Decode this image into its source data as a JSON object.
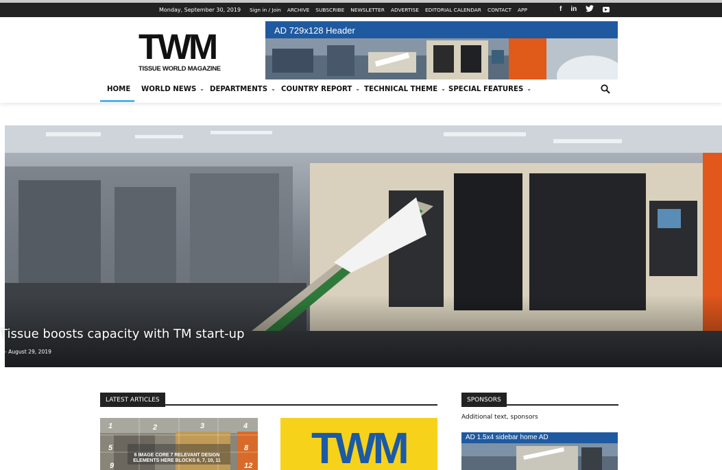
{
  "topbar": {
    "date": "Monday, September 30, 2019",
    "links": [
      "Sign in / Join",
      "ARCHIVE",
      "SUBSCRIBE",
      "NEWSLETTER",
      "ADVERTISE",
      "EDITORIAL CALENDAR",
      "CONTACT",
      "APP"
    ],
    "social": [
      "facebook-icon",
      "linkedin-icon",
      "twitter-icon",
      "youtube-icon"
    ]
  },
  "logo": {
    "mark": "TWM",
    "subtitle": "TISSUE WORLD MAGAZINE"
  },
  "header_ad": {
    "label": "AD 729x128 Header"
  },
  "nav": {
    "items": [
      "HOME",
      "WORLD NEWS",
      "DEPARTMENTS",
      "COUNTRY REPORT",
      "TECHNICAL THEME",
      "SPECIAL FEATURES"
    ],
    "active": "HOME",
    "accent_color": "#4db2ec"
  },
  "hero": {
    "title": "Tissue boosts capacity with TM start-up",
    "date": "- August 29, 2019"
  },
  "latest": {
    "heading": "LATEST ARTICLES",
    "thumb1_text": "6 IMAGE CORE 7 RELEVANT DESIGN ELEMENTS HERE BLOCKS 6, 7, 10, 11",
    "thumb1_numbers": [
      "1",
      "2",
      "3",
      "4",
      "5",
      "8",
      "9",
      "12"
    ],
    "thumb2_mark": "TWM"
  },
  "sponsors": {
    "heading": "SPONSORS",
    "text": "Additional text, sponsors",
    "ad_label": "AD 1.5x4 sidebar home AD"
  }
}
